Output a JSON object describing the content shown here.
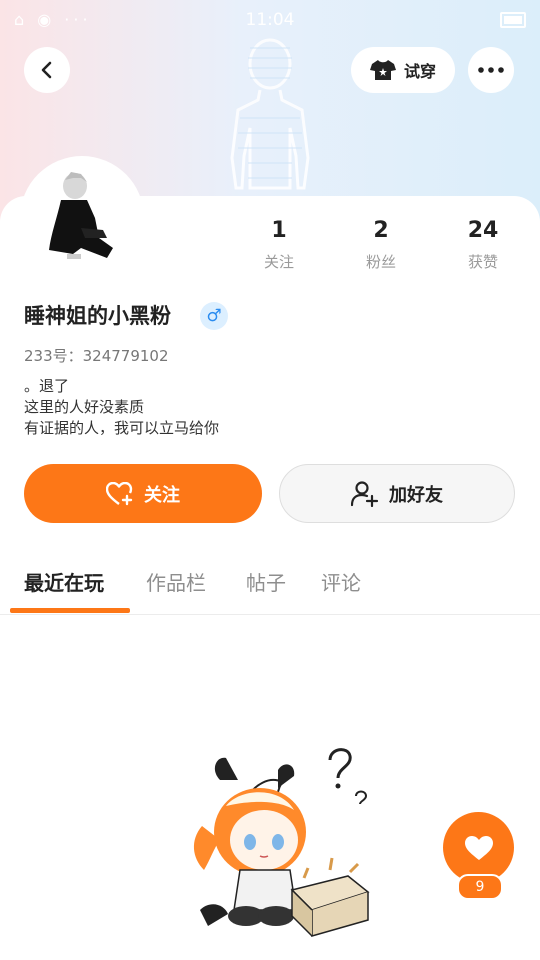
{
  "status_bar": {
    "time": "11:04"
  },
  "header": {
    "try_on_label": "试穿"
  },
  "profile": {
    "username": "睡神姐的小黑粉",
    "gender_symbol": "♂",
    "uid_text": "233号：324779102",
    "bio_lines": [
      "。退了",
      "这里的人好没素质",
      "有证据的人，我可以立马给你"
    ]
  },
  "stats": [
    {
      "value": "1",
      "label": "关注"
    },
    {
      "value": "2",
      "label": "粉丝"
    },
    {
      "value": "24",
      "label": "获赞"
    }
  ],
  "actions": {
    "follow_label": "关注",
    "add_friend_label": "加好友"
  },
  "tabs": [
    "最近在玩",
    "作品栏",
    "帖子",
    "评论"
  ],
  "like": {
    "count": "9"
  },
  "colors": {
    "accent": "#fd7717",
    "gender_blue": "#2a8cf0"
  },
  "icons": [
    "back-icon",
    "shirt-icon",
    "more-icon",
    "heart-plus-icon",
    "person-plus-icon",
    "heart-icon"
  ]
}
